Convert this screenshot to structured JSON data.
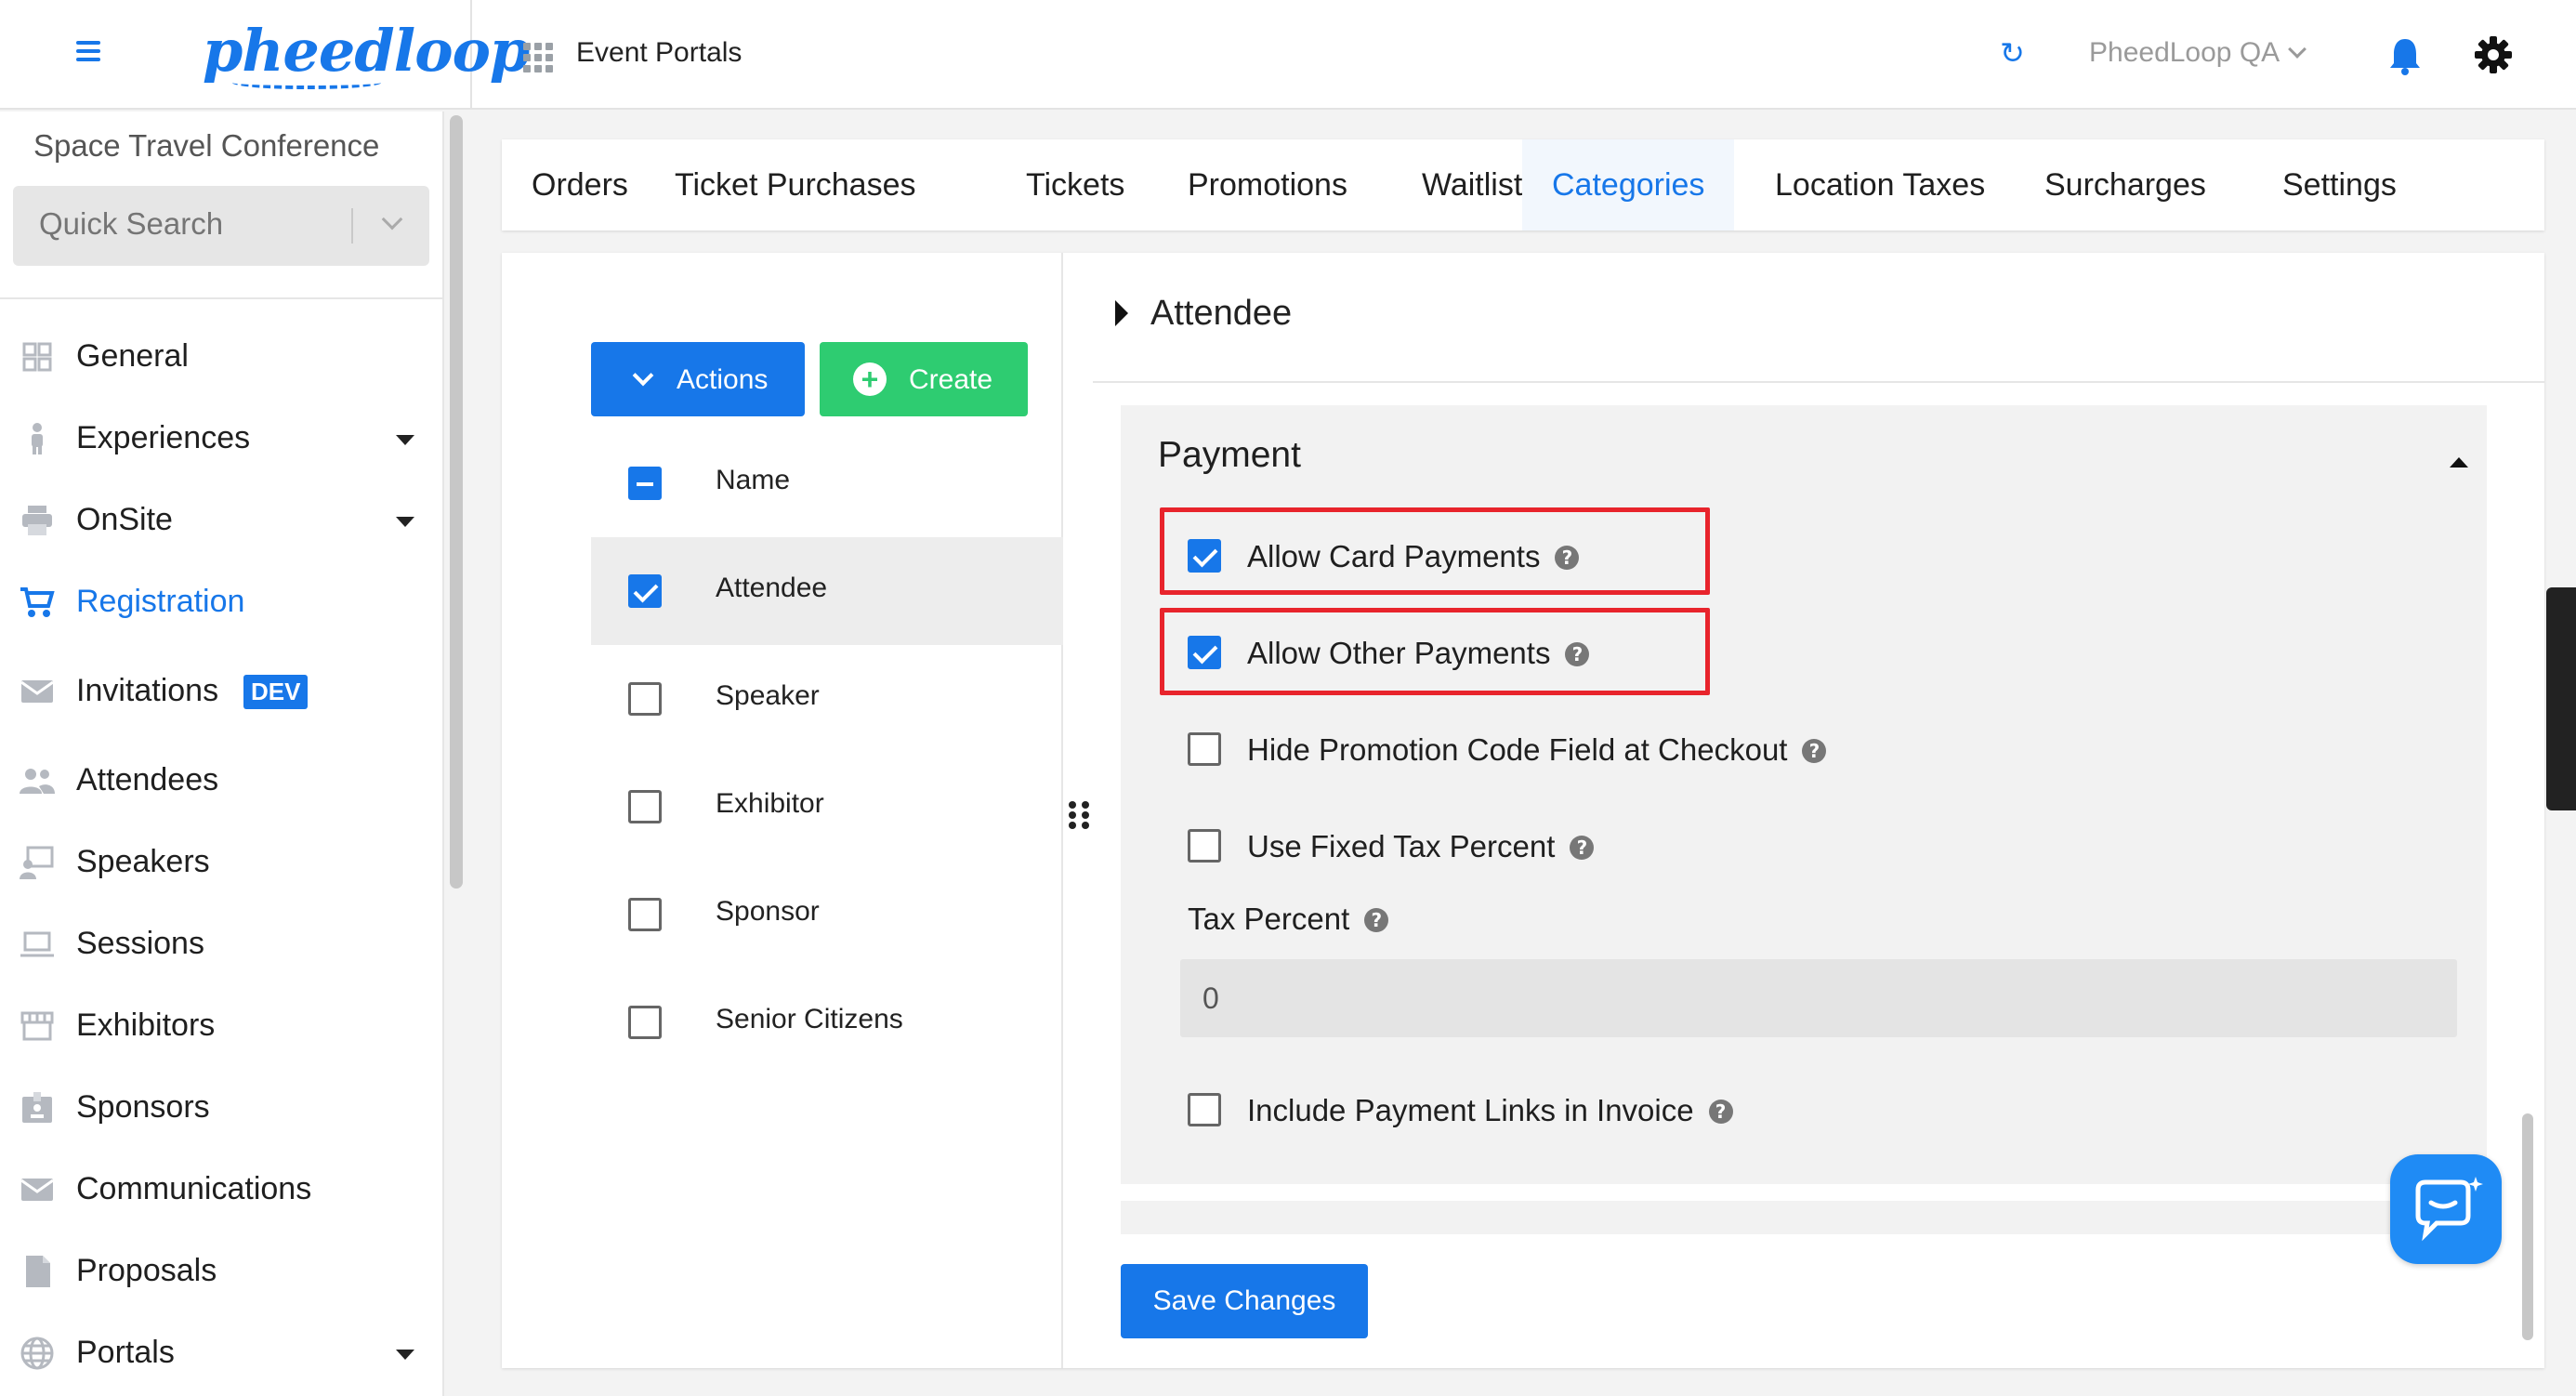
{
  "header": {
    "logo_text": "pheedloop",
    "app_title": "Event Portals",
    "account_name": "PheedLoop QA"
  },
  "sidebar": {
    "event_name": "Space Travel Conference",
    "search_placeholder": "Quick Search",
    "items": [
      {
        "label": "General",
        "icon": "grid-icon"
      },
      {
        "label": "Experiences",
        "icon": "person-icon",
        "expandable": true
      },
      {
        "label": "OnSite",
        "icon": "printer-icon",
        "expandable": true
      },
      {
        "label": "Registration",
        "icon": "cart-icon",
        "active": true
      },
      {
        "label": "Invitations",
        "icon": "mail-icon",
        "badge": "DEV"
      },
      {
        "label": "Attendees",
        "icon": "people-icon"
      },
      {
        "label": "Speakers",
        "icon": "speaker-icon"
      },
      {
        "label": "Sessions",
        "icon": "laptop-icon"
      },
      {
        "label": "Exhibitors",
        "icon": "store-icon"
      },
      {
        "label": "Sponsors",
        "icon": "badge-icon"
      },
      {
        "label": "Communications",
        "icon": "envelope-icon"
      },
      {
        "label": "Proposals",
        "icon": "document-icon"
      },
      {
        "label": "Portals",
        "icon": "globe-icon",
        "expandable": true
      }
    ]
  },
  "tabs": [
    {
      "label": "Orders"
    },
    {
      "label": "Ticket Purchases"
    },
    {
      "label": "Tickets"
    },
    {
      "label": "Promotions"
    },
    {
      "label": "Waitlist"
    },
    {
      "label": "Categories",
      "active": true
    },
    {
      "label": "Location Taxes"
    },
    {
      "label": "Surcharges"
    },
    {
      "label": "Settings"
    }
  ],
  "categories": {
    "actions_label": "Actions",
    "create_label": "Create",
    "header_label": "Name",
    "rows": [
      {
        "label": "Attendee",
        "checked": true
      },
      {
        "label": "Speaker",
        "checked": false
      },
      {
        "label": "Exhibitor",
        "checked": false
      },
      {
        "label": "Sponsor",
        "checked": false
      },
      {
        "label": "Senior Citizens",
        "checked": false
      }
    ]
  },
  "detail": {
    "section_title": "Attendee",
    "payment_title": "Payment",
    "options": {
      "card": {
        "label": "Allow Card Payments",
        "checked": true
      },
      "other": {
        "label": "Allow Other Payments",
        "checked": true
      },
      "hide_promo": {
        "label": "Hide Promotion Code Field at Checkout",
        "checked": false
      },
      "fixed_tax": {
        "label": "Use Fixed Tax Percent",
        "checked": false
      },
      "invoice_links": {
        "label": "Include Payment Links in Invoice",
        "checked": false
      }
    },
    "tax_percent_label": "Tax Percent",
    "tax_percent_value": "0",
    "save_label": "Save Changes"
  },
  "colors": {
    "accent": "#1777e9",
    "create_green": "#2ecc71",
    "highlight_red": "#e8242c"
  }
}
